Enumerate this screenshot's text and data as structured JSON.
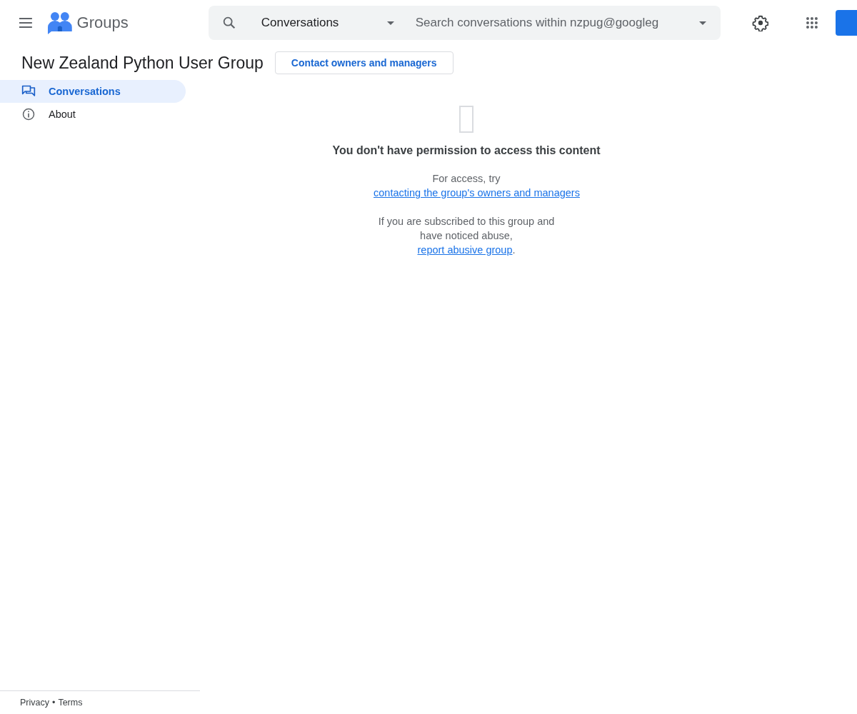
{
  "header": {
    "app_name": "Groups",
    "search_scope": "Conversations",
    "search": {
      "placeholder": "Search conversations within nzpug@googleg"
    }
  },
  "group": {
    "title": "New Zealand Python User Group",
    "contact_button": "Contact owners and managers"
  },
  "sidebar": {
    "items": [
      {
        "label": "Conversations",
        "kind": "conversations",
        "selected": true
      },
      {
        "label": "About",
        "kind": "about",
        "selected": false
      }
    ]
  },
  "message": {
    "title": "You don't have permission to access this content",
    "paragraphs": [
      [
        {
          "kind": "text",
          "text": "For access, try"
        },
        {
          "kind": "link",
          "text": "contacting the group's owners and managers"
        }
      ],
      [
        {
          "kind": "text",
          "text": "If you are subscribed to this group and have noticed abuse,"
        },
        {
          "kind": "link",
          "text": "report abusive group"
        },
        {
          "kind": "text",
          "text": "."
        }
      ]
    ]
  },
  "footer": {
    "links": [
      "Privacy",
      "Terms"
    ],
    "separator": "•"
  }
}
